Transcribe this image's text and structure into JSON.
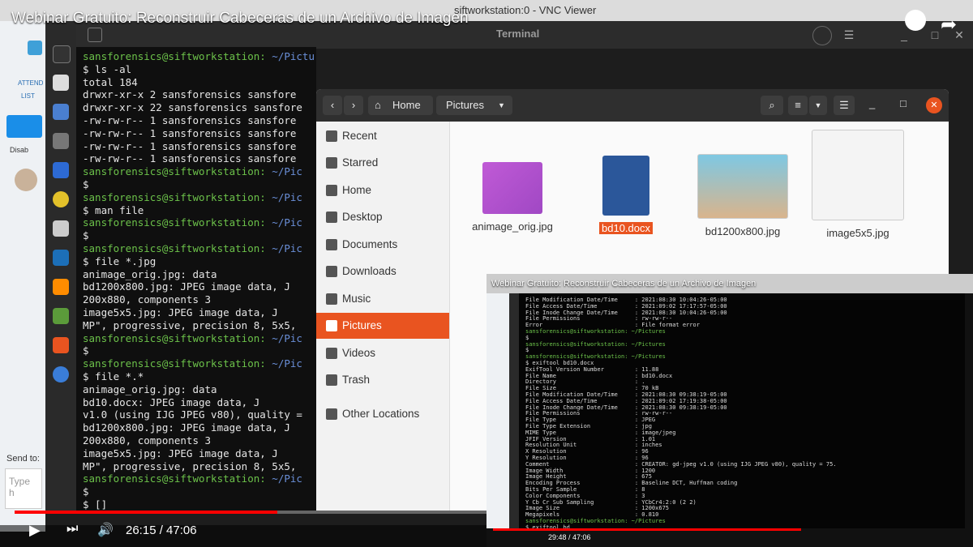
{
  "vnc": {
    "window_title": "siftworkstation:0 - VNC Viewer"
  },
  "video": {
    "title": "Webinar Gratuito: Reconstruir Cabeceras de un Archivo de Imagen",
    "time": "26:15 / 47:06",
    "progress": 0.557
  },
  "left_panel": {
    "attendees": "ATTEND",
    "list": "LIST",
    "disable": "Disab",
    "send_to": "Send to:",
    "type_here": "Type h"
  },
  "terminal": {
    "title": "Terminal",
    "lines": [
      {
        "p": "sansforensics@siftworkstation:",
        "path": " ~/Pictures",
        "t": ""
      },
      {
        "p": "",
        "path": "",
        "t": "$ ls -al"
      },
      {
        "p": "",
        "path": "",
        "t": "total 184"
      },
      {
        "p": "",
        "path": "",
        "t": "drwxr-xr-x  2 sansforensics sansfore"
      },
      {
        "p": "",
        "path": "",
        "t": "drwxr-xr-x 22 sansforensics sansfore"
      },
      {
        "p": "",
        "path": "",
        "t": "-rw-rw-r--  1 sansforensics sansfore"
      },
      {
        "p": "",
        "path": "",
        "t": "-rw-rw-r--  1 sansforensics sansfore"
      },
      {
        "p": "",
        "path": "",
        "t": "-rw-rw-r--  1 sansforensics sansfore"
      },
      {
        "p": "",
        "path": "",
        "t": "-rw-rw-r--  1 sansforensics sansfore"
      },
      {
        "p": "sansforensics@siftworkstation:",
        "path": " ~/Pic",
        "t": ""
      },
      {
        "p": "",
        "path": "",
        "t": "$"
      },
      {
        "p": "sansforensics@siftworkstation:",
        "path": " ~/Pic",
        "t": ""
      },
      {
        "p": "",
        "path": "",
        "t": "$ man file"
      },
      {
        "p": "sansforensics@siftworkstation:",
        "path": " ~/Pic",
        "t": ""
      },
      {
        "p": "",
        "path": "",
        "t": "$"
      },
      {
        "p": "sansforensics@siftworkstation:",
        "path": " ~/Pic",
        "t": ""
      },
      {
        "p": "",
        "path": "",
        "t": "$ file *.jpg"
      },
      {
        "p": "",
        "path": "",
        "t": "animage_orig.jpg: data"
      },
      {
        "p": "",
        "path": "",
        "t": "bd1200x800.jpg:   JPEG image data, J"
      },
      {
        "p": "",
        "path": "",
        "t": "200x880, components 3"
      },
      {
        "p": "",
        "path": "",
        "t": "image5x5.jpg:     JPEG image data, J"
      },
      {
        "p": "",
        "path": "",
        "t": "MP\", progressive, precision 8, 5x5,"
      },
      {
        "p": "sansforensics@siftworkstation:",
        "path": " ~/Pic",
        "t": ""
      },
      {
        "p": "",
        "path": "",
        "t": "$"
      },
      {
        "p": "sansforensics@siftworkstation:",
        "path": " ~/Pic",
        "t": ""
      },
      {
        "p": "",
        "path": "",
        "t": "$ file *.*"
      },
      {
        "p": "",
        "path": "",
        "t": "animage_orig.jpg: data"
      },
      {
        "p": "",
        "path": "",
        "t": "bd10.docx:        JPEG image data, J"
      },
      {
        "p": "",
        "path": "",
        "t": "v1.0 (using IJG JPEG v80), quality ="
      },
      {
        "p": "",
        "path": "",
        "t": "bd1200x800.jpg:   JPEG image data, J"
      },
      {
        "p": "",
        "path": "",
        "t": "200x880, components 3"
      },
      {
        "p": "",
        "path": "",
        "t": "image5x5.jpg:     JPEG image data, J"
      },
      {
        "p": "",
        "path": "",
        "t": "MP\", progressive, precision 8, 5x5,"
      },
      {
        "p": "sansforensics@siftworkstation:",
        "path": " ~/Pic",
        "t": ""
      },
      {
        "p": "",
        "path": "",
        "t": "$"
      },
      {
        "p": "",
        "path": "",
        "t": "$ []"
      }
    ]
  },
  "file_manager": {
    "path_home": "Home",
    "path_current": "Pictures",
    "sidebar": [
      "Recent",
      "Starred",
      "Home",
      "Desktop",
      "Documents",
      "Downloads",
      "Music",
      "Pictures",
      "Videos",
      "Trash",
      "Other Locations"
    ],
    "active_index": 7,
    "files": [
      "animage_orig.jpg",
      "bd10.docx",
      "bd1200x800.jpg",
      "image5x5.jpg"
    ]
  },
  "pip": {
    "title": "Webinar Gratuito: Reconstruir Cabeceras de un Archivo de Imagen",
    "time": "29:48 / 47:06",
    "lines": [
      "File Modification Date/Time     : 2021:08:30 10:04:26-05:00",
      "File Access Date/Time           : 2021:09:02 17:17:57-05:00",
      "File Inode Change Date/Time     : 2021:08:30 10:04:26-05:00",
      "File Permissions                : rw-rw-r--",
      "Error                           : File format error",
      "sansforensics@siftworkstation: ~/Pictures",
      "$",
      "sansforensics@siftworkstation: ~/Pictures",
      "$",
      "sansforensics@siftworkstation: ~/Pictures",
      "$ exiftool bd10.docx",
      "ExifTool Version Number         : 11.88",
      "File Name                       : bd10.docx",
      "Directory                       : .",
      "File Size                       : 70 kB",
      "File Modification Date/Time     : 2021:08:30 09:38:19-05:00",
      "File Access Date/Time           : 2021:09:02 17:19:38-05:00",
      "File Inode Change Date/Time     : 2021:08:30 09:38:19-05:00",
      "File Permissions                : rw-rw-r--",
      "File Type                       : JPEG",
      "File Type Extension             : jpg",
      "MIME Type                       : image/jpeg",
      "JFIF Version                    : 1.01",
      "Resolution Unit                 : inches",
      "X Resolution                    : 96",
      "Y Resolution                    : 96",
      "Comment                         : CREATOR: gd-jpeg v1.0 (using IJG JPEG v80), quality = 75.",
      "Image Width                     : 1200",
      "Image Height                    : 675",
      "Encoding Process                : Baseline DCT, Huffman coding",
      "Bits Per Sample                 : 8",
      "Color Components                : 3",
      "Y Cb Cr Sub Sampling            : YCbCr4:2:0 (2 2)",
      "Image Size                      : 1200x675",
      "Megapixels                      : 0.810",
      "sansforensics@siftworkstation: ~/Pictures",
      "$ exiftool bd"
    ]
  }
}
